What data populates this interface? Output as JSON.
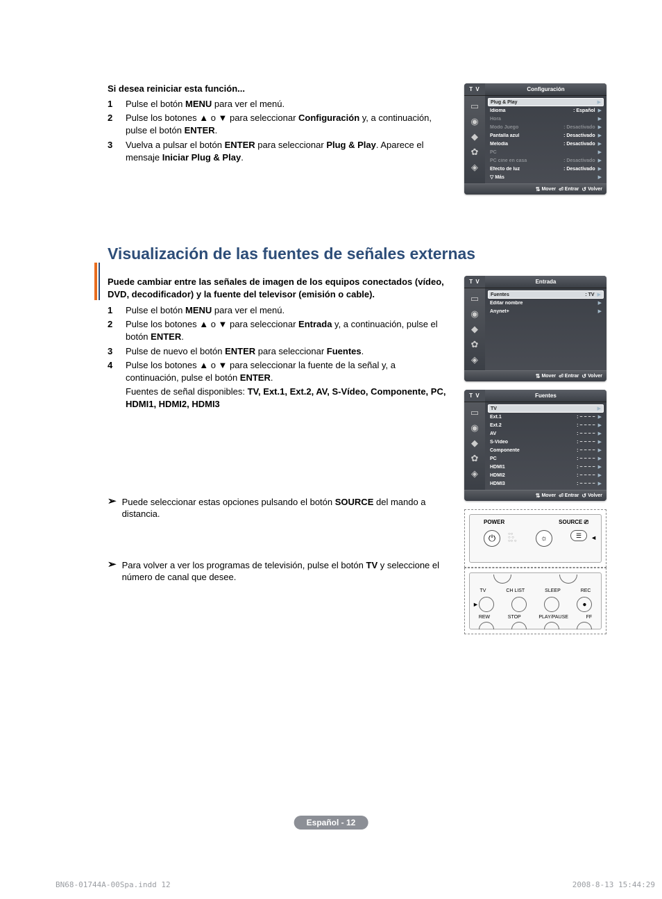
{
  "restart": {
    "heading": "Si desea reiniciar esta función...",
    "step1_pre": "Pulse el botón ",
    "step1_b1": "MENU",
    "step1_post": " para ver el menú.",
    "step2_pre": "Pulse los botones ▲ o ▼ para seleccionar ",
    "step2_b1": "Configuración",
    "step2_mid": " y, a continuación, pulse el botón ",
    "step2_b2": "ENTER",
    "step2_post": ".",
    "step3_pre": "Vuelva a pulsar el botón ",
    "step3_b1": "ENTER",
    "step3_mid": " para seleccionar ",
    "step3_b2": "Plug & Play",
    "step3_post": ". Aparece el mensaje ",
    "step3_b3": "Iniciar Plug & Play",
    "step3_end": "."
  },
  "osd_config": {
    "tv": "T V",
    "title": "Configuración",
    "rows": [
      {
        "label": "Plug & Play",
        "val": "",
        "sel": true
      },
      {
        "label": "Idioma",
        "val": ": Español"
      },
      {
        "label": "Hora",
        "val": "",
        "dim": true
      },
      {
        "label": "Modo Juego",
        "val": ": Desactivado",
        "dim": true
      },
      {
        "label": "Pantalla azul",
        "val": ": Desactivado"
      },
      {
        "label": "Melodía",
        "val": ": Desactivado"
      },
      {
        "label": "PC",
        "val": "",
        "dim": true
      },
      {
        "label": "PC cine en casa",
        "val": ": Desactivado",
        "dim": true
      },
      {
        "label": "Efecto de luz",
        "val": ": Desactivado"
      },
      {
        "label": "▽ Más",
        "val": ""
      }
    ],
    "footer": {
      "mover": "Mover",
      "entrar": "Entrar",
      "volver": "Volver"
    }
  },
  "section": {
    "title": "Visualización de las fuentes de señales externas",
    "intro": "Puede cambiar entre las señales de imagen de los equipos conectados (vídeo, DVD, decodificador) y la fuente del televisor (emisión o cable).",
    "step1_pre": "Pulse el botón ",
    "step1_b1": "MENU",
    "step1_post": " para ver el menú.",
    "step2_pre": "Pulse los botones ▲ o ▼ para seleccionar  ",
    "step2_b1": "Entrada",
    "step2_mid": " y, a continuación, pulse el botón ",
    "step2_b2": "ENTER",
    "step2_post": ".",
    "step3_pre": "Pulse de nuevo el botón ",
    "step3_b1": "ENTER",
    "step3_mid": " para seleccionar ",
    "step3_b2": "Fuentes",
    "step3_post": ".",
    "step4_pre": "Pulse los botones ▲ o ▼ para seleccionar la fuente de la señal y, a continuación, pulse el botón ",
    "step4_b1": "ENTER",
    "step4_post": ".",
    "avail_pre": "Fuentes de señal disponibles: ",
    "avail_list": "TV, Ext.1, Ext.2, AV, S-Vídeo, Componente, PC, HDMI1, HDMI2, HDMI3",
    "note1_pre": "Puede seleccionar estas opciones pulsando el botón ",
    "note1_b1": "SOURCE",
    "note1_post": " del mando a distancia.",
    "note2_pre": "Para volver a ver los programas de televisión, pulse el botón ",
    "note2_b1": "TV",
    "note2_post": " y seleccione el número de canal que desee."
  },
  "osd_entrada": {
    "tv": "T V",
    "title": "Entrada",
    "rows": [
      {
        "label": "Fuentes",
        "val": ": TV",
        "sel": true
      },
      {
        "label": "Editar nombre",
        "val": ""
      },
      {
        "label": "Anynet+",
        "val": ""
      }
    ],
    "footer": {
      "mover": "Mover",
      "entrar": "Entrar",
      "volver": "Volver"
    }
  },
  "osd_fuentes": {
    "tv": "T V",
    "title": "Fuentes",
    "rows": [
      {
        "label": "TV",
        "val": "",
        "sel": true
      },
      {
        "label": "Ext.1",
        "val": ": − − − −"
      },
      {
        "label": "Ext.2",
        "val": ": − − − −"
      },
      {
        "label": "AV",
        "val": ": − − − −"
      },
      {
        "label": "S-Vídeo",
        "val": ": − − − −"
      },
      {
        "label": "Componente",
        "val": ": − − − −"
      },
      {
        "label": "PC",
        "val": ": − − − −"
      },
      {
        "label": "HDMI1",
        "val": ": − − − −"
      },
      {
        "label": "HDMI2",
        "val": ": − − − −"
      },
      {
        "label": "HDMI3",
        "val": ": − − − −"
      }
    ],
    "footer": {
      "mover": "Mover",
      "entrar": "Entrar",
      "volver": "Volver"
    }
  },
  "remote": {
    "power": "POWER",
    "source": "SOURCE",
    "tv": "TV",
    "chlist": "CH LIST",
    "sleep": "SLEEP",
    "rec": "REC",
    "rew": "REW",
    "stop": "STOP",
    "playpause": "PLAY/PAUSE",
    "ff": "FF"
  },
  "page_pill": "Español - 12",
  "footer": {
    "left": "BN68-01744A-00Spa.indd   12",
    "right": "2008-8-13   15:44:29"
  }
}
